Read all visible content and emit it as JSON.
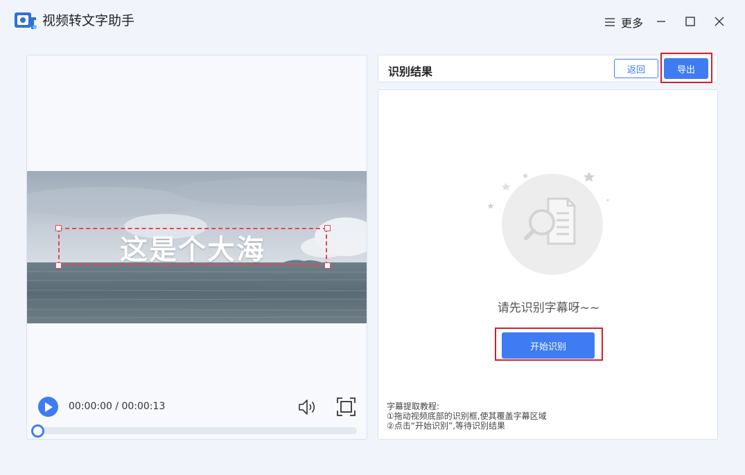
{
  "app": {
    "title": "视频转文字助手",
    "more_label": "更多"
  },
  "video": {
    "subtitle": "这是个大海",
    "time_display": "00:00:00 / 00:00:13",
    "progress_percent": 0
  },
  "result": {
    "title": "识别结果",
    "back_label": "返回",
    "export_label": "导出",
    "empty_message": "请先识别字幕呀~~",
    "start_label": "开始识别",
    "tutorial": {
      "heading": "字幕提取教程:",
      "step1": "①拖动视频底部的识别框,使其覆盖字幕区域",
      "step2": "②点击“开始识别”,等待识别结果"
    }
  },
  "colors": {
    "accent": "#3f7cf3",
    "highlight": "#d61f26",
    "subtitle_box": "#e2484f"
  }
}
